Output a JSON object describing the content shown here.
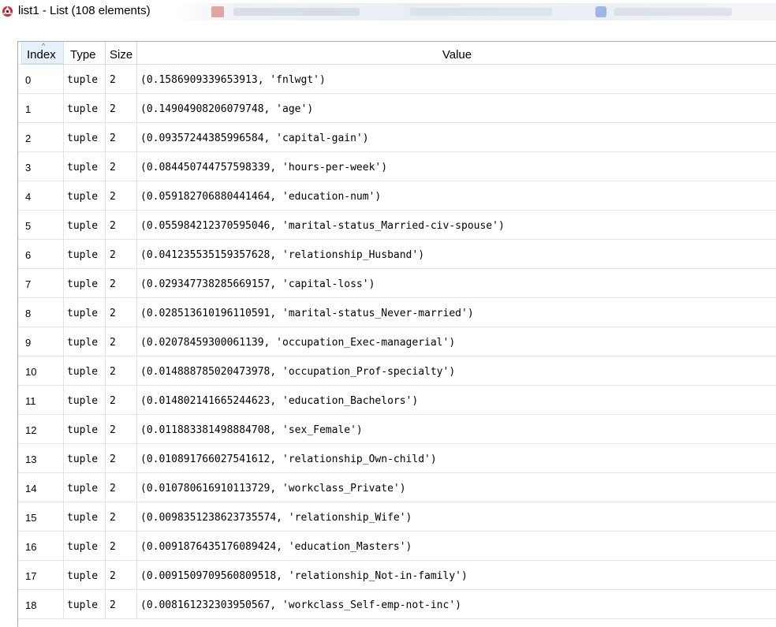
{
  "window": {
    "title": "list1 - List (108 elements)",
    "icon": "app-logo-icon"
  },
  "table": {
    "headers": {
      "index": "Index",
      "type": "Type",
      "size": "Size",
      "value": "Value"
    },
    "sort_indicator": "^",
    "rows": [
      {
        "index": "0",
        "type": "tuple",
        "size": "2",
        "value": "(0.1586909339653913, 'fnlwgt')"
      },
      {
        "index": "1",
        "type": "tuple",
        "size": "2",
        "value": "(0.14904908206079748, 'age')"
      },
      {
        "index": "2",
        "type": "tuple",
        "size": "2",
        "value": "(0.09357244385996584, 'capital-gain')"
      },
      {
        "index": "3",
        "type": "tuple",
        "size": "2",
        "value": "(0.084450744757598339, 'hours-per-week')"
      },
      {
        "index": "4",
        "type": "tuple",
        "size": "2",
        "value": "(0.059182706880441464, 'education-num')"
      },
      {
        "index": "5",
        "type": "tuple",
        "size": "2",
        "value": "(0.055984212370595046, 'marital-status_Married-civ-spouse')"
      },
      {
        "index": "6",
        "type": "tuple",
        "size": "2",
        "value": "(0.041235535159357628, 'relationship_Husband')"
      },
      {
        "index": "7",
        "type": "tuple",
        "size": "2",
        "value": "(0.029347738285669157, 'capital-loss')"
      },
      {
        "index": "8",
        "type": "tuple",
        "size": "2",
        "value": "(0.028513610196110591, 'marital-status_Never-married')"
      },
      {
        "index": "9",
        "type": "tuple",
        "size": "2",
        "value": "(0.02078459300061139, 'occupation_Exec-managerial')"
      },
      {
        "index": "10",
        "type": "tuple",
        "size": "2",
        "value": "(0.014888785020473978, 'occupation_Prof-specialty')"
      },
      {
        "index": "11",
        "type": "tuple",
        "size": "2",
        "value": "(0.014802141665244623, 'education_Bachelors')"
      },
      {
        "index": "12",
        "type": "tuple",
        "size": "2",
        "value": "(0.011883381498884708, 'sex_Female')"
      },
      {
        "index": "13",
        "type": "tuple",
        "size": "2",
        "value": "(0.010891766027541612, 'relationship_Own-child')"
      },
      {
        "index": "14",
        "type": "tuple",
        "size": "2",
        "value": "(0.010780616910113729, 'workclass_Private')"
      },
      {
        "index": "15",
        "type": "tuple",
        "size": "2",
        "value": "(0.0098351238623735574, 'relationship_Wife')"
      },
      {
        "index": "16",
        "type": "tuple",
        "size": "2",
        "value": "(0.0091876435176089424, 'education_Masters')"
      },
      {
        "index": "17",
        "type": "tuple",
        "size": "2",
        "value": "(0.0091509709560809518, 'relationship_Not-in-family')"
      },
      {
        "index": "18",
        "type": "tuple",
        "size": "2",
        "value": "(0.008161232303950567, 'workclass_Self-emp-not-inc')"
      }
    ]
  },
  "colors": {
    "header_selected_bg": "#e6f1fb",
    "grid_line": "#e4e4e4",
    "frame_border": "#a9a9a9"
  }
}
